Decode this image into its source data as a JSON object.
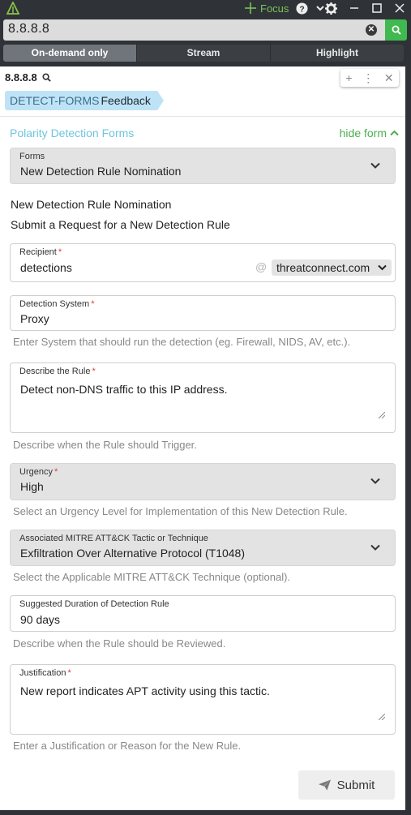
{
  "titlebar": {
    "focus_label": "Focus",
    "icons": [
      "polarity-logo",
      "focus-crosshair-icon",
      "help-icon",
      "chevron-down-icon",
      "gear-icon",
      "minimize-icon",
      "maximize-icon",
      "close-icon"
    ]
  },
  "search": {
    "value": "8.8.8.8"
  },
  "modes": [
    {
      "label": "On-demand only",
      "active": true
    },
    {
      "label": "Stream",
      "active": false
    },
    {
      "label": "Highlight",
      "active": false
    }
  ],
  "entity": {
    "value": "8.8.8.8"
  },
  "integration": {
    "acronym": "DETECT-FORMS",
    "name": "Feedback",
    "color": "#bfe3f6"
  },
  "form_header": {
    "title": "Polarity Detection Forms",
    "hide_label": "hide form"
  },
  "forms_select": {
    "label": "Forms",
    "value": "New Detection Rule Nomination"
  },
  "form_title": "New Detection Rule Nomination",
  "form_subtitle": "Submit a Request for a New Detection Rule",
  "recipient": {
    "label": "Recipient",
    "required": "*",
    "value": "detections",
    "at": "@",
    "domain": "threatconnect.com"
  },
  "detection_system": {
    "label": "Detection System",
    "required": "*",
    "value": "Proxy",
    "help": "Enter System that should run the detection (eg. Firewall, NIDS, AV, etc.)."
  },
  "describe_rule": {
    "label": "Describe the Rule",
    "required": "*",
    "value": "Detect non-DNS traffic to this IP address.",
    "help": "Describe when the Rule should Trigger."
  },
  "urgency": {
    "label": "Urgency",
    "required": "*",
    "value": "High",
    "help": "Select an Urgency Level for Implementation of this New Detection Rule."
  },
  "mitre": {
    "label": "Associated MITRE ATT&CK Tactic or Technique",
    "value": "Exfiltration Over Alternative Protocol (T1048)",
    "help": "Select the Applicable MITRE ATT&CK Technique (optional)."
  },
  "duration": {
    "label": "Suggested Duration of Detection Rule",
    "value": "90 days",
    "help": "Describe when the Rule should be Reviewed."
  },
  "justification": {
    "label": "Justification",
    "required": "*",
    "value": "New report indicates APT activity using this tactic.",
    "help": "Enter a Justification or Reason for the New Rule."
  },
  "submit_label": "Submit",
  "colors": {
    "accent_green": "#3fb950",
    "link_blue": "#6ec5e0",
    "required_red": "#d43f3f",
    "chrome_dark": "#2f3338"
  }
}
